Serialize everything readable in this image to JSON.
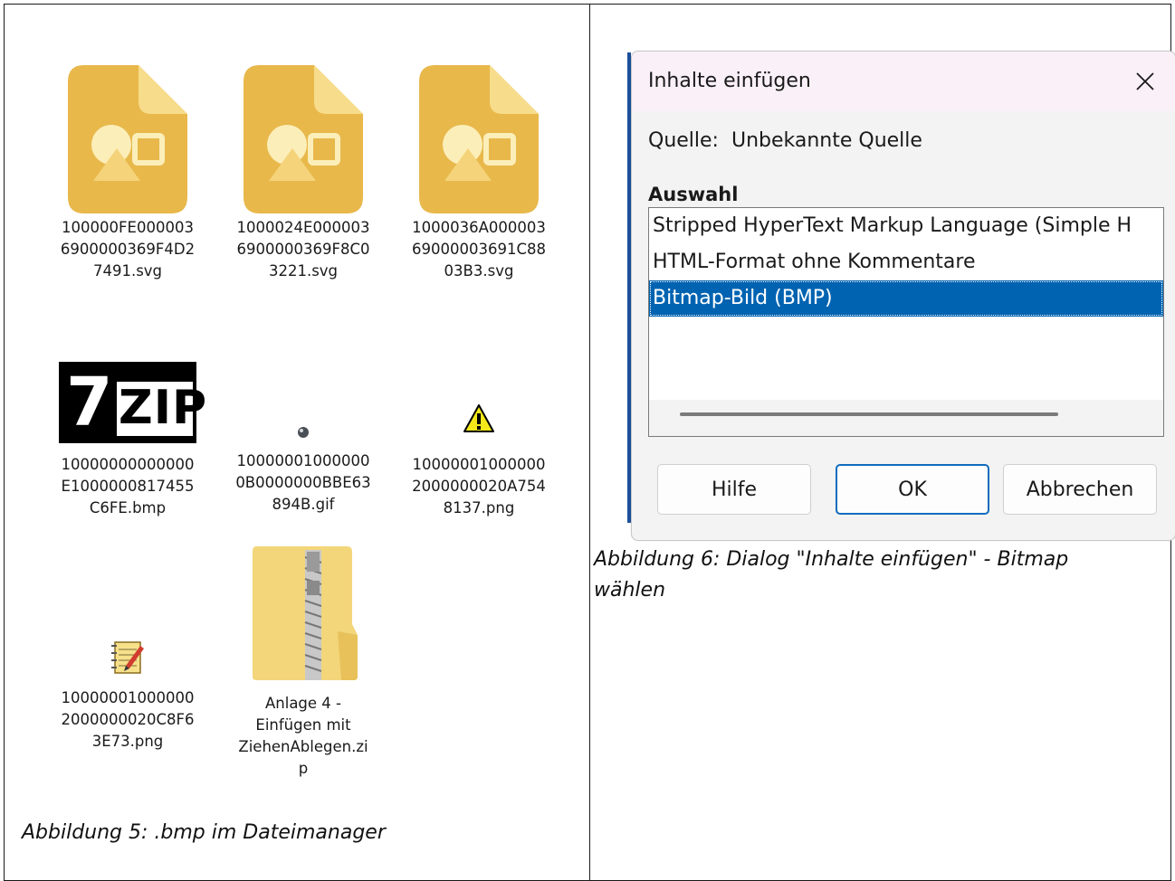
{
  "left_panel": {
    "files": [
      {
        "icon": "image-file-icon",
        "name": "100000FE0000036900000369F4D27491.svg",
        "lines": [
          "100000FE000003",
          "6900000369F4D2",
          "7491.svg"
        ]
      },
      {
        "icon": "image-file-icon",
        "name": "1000024E0000036900000369F8C03221.svg",
        "lines": [
          "1000024E000003",
          "6900000369F8C0",
          "3221.svg"
        ]
      },
      {
        "icon": "image-file-icon",
        "name": "1000036A0000036900000369 1C8803B3.svg",
        "lines": [
          "1000036A000003",
          "69000003691C88",
          "03B3.svg"
        ]
      },
      {
        "icon": "7zip-thumbnail-icon",
        "name": "10000000000000E1000000817455C6FE.bmp",
        "lines": [
          "10000000000000",
          "E1000000817455",
          "C6FE.bmp"
        ]
      },
      {
        "icon": "small-ball-icon",
        "name": "100000010000000B0000000BBE63894B.gif",
        "lines": [
          "10000001000000",
          "0B0000000BBE63",
          "894B.gif"
        ]
      },
      {
        "icon": "warning-icon",
        "name": "100000010000002000000020A7548137.png",
        "lines": [
          "10000001000000",
          "2000000020A754",
          "8137.png"
        ]
      },
      {
        "icon": "notepad-icon",
        "name": "1000000100000020000000 20C8F63E73.png",
        "lines": [
          "10000001000000",
          "2000000020C8F6",
          "3E73.png"
        ]
      },
      {
        "icon": "zip-folder-icon",
        "name": "Anlage 4 - Einfügen mit ZiehenAblegen.zip",
        "lines": [
          "Anlage 4 -",
          "Einfügen mit",
          "ZiehenAblegen.zi",
          "p"
        ]
      }
    ],
    "seven_zip": {
      "left": "7",
      "right": "ZIP"
    },
    "caption": "Abbildung 5: .bmp im Dateimanager"
  },
  "dialog": {
    "title": "Inhalte einfügen",
    "source_label": "Quelle:",
    "source_value": "Unbekannte Quelle",
    "selection_label": "Auswahl",
    "items": [
      {
        "label": "Stripped HyperText Markup Language (Simple H",
        "selected": false
      },
      {
        "label": "HTML-Format ohne Kommentare",
        "selected": false
      },
      {
        "label": "Bitmap-Bild (BMP)",
        "selected": true
      }
    ],
    "buttons": {
      "help": "Hilfe",
      "ok": "OK",
      "cancel": "Abbrechen"
    },
    "colors": {
      "selection": "#0063b1",
      "title_bar": "#faf0f7",
      "ok_border": "#0f6cbd"
    }
  },
  "right_panel": {
    "caption_line1": "Abbildung 6: Dialog \"Inhalte einfügen\" - Bitmap",
    "caption_line2": "wählen"
  }
}
